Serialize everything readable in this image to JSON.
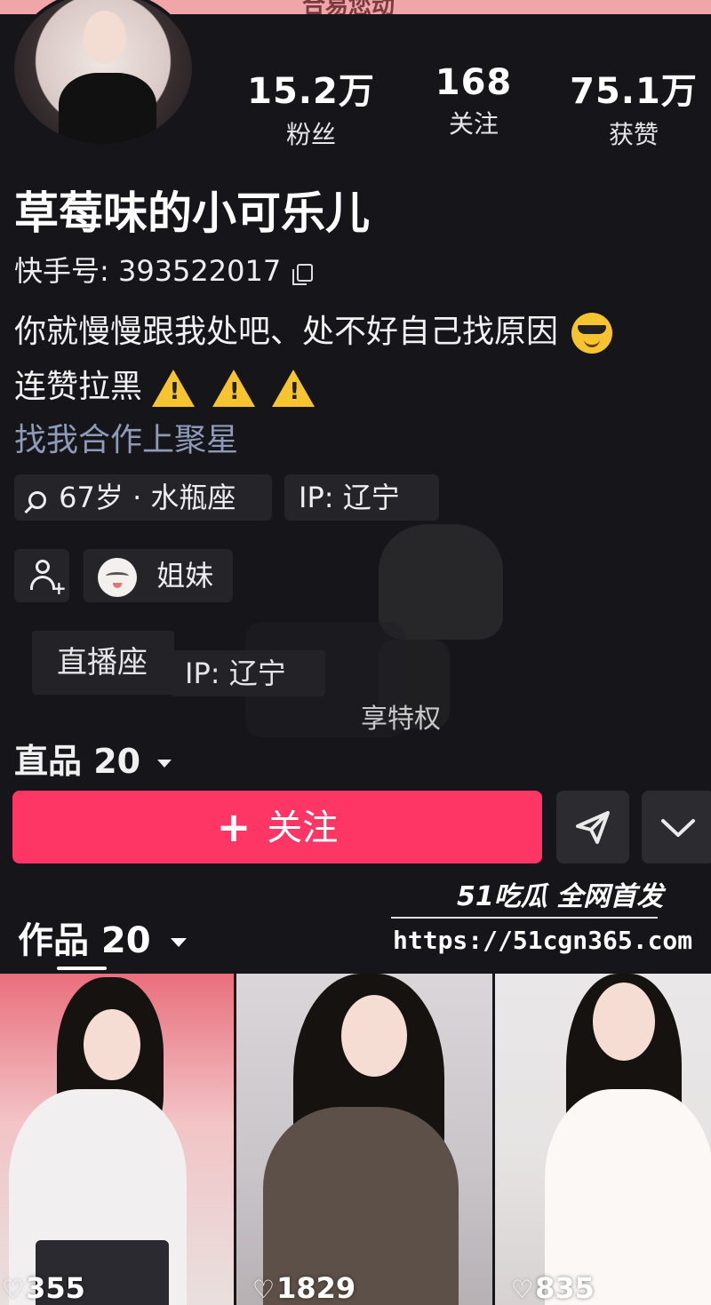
{
  "banner": {
    "text": "合易您动"
  },
  "stats": [
    {
      "value": "15.2万",
      "label": "粉丝"
    },
    {
      "value": "168",
      "label": "关注"
    },
    {
      "value": "75.1万",
      "label": "获赞"
    }
  ],
  "profile": {
    "nickname": "草莓味的小可乐儿",
    "id_label": "快手号: 393522017",
    "bio_line1": "你就慢慢跟我处吧、处不好自己找原因",
    "bio_line2": "连赞拉黑",
    "bio_line3": "找我合作上聚星"
  },
  "tags": {
    "age": "67岁 · 水瓶座",
    "ip": "IP: 辽宁",
    "sister": "姐妹"
  },
  "ghost": {
    "live": "直播座",
    "ip": "IP: 辽宁",
    "privilege": "享特权",
    "works": "直品 20"
  },
  "actions": {
    "follow": "关注"
  },
  "works_tab": {
    "label": "作品 20"
  },
  "watermark": {
    "logo": "51吃瓜 全网首发",
    "url": "https://51cgn365.com"
  },
  "videos": [
    {
      "likes": "355"
    },
    {
      "likes": "1829"
    },
    {
      "likes": "835"
    }
  ],
  "colors": {
    "background": "#161519",
    "follow_button": "#fe3666",
    "link_text": "#8e9bb8",
    "banner": "#f0a5a8"
  }
}
